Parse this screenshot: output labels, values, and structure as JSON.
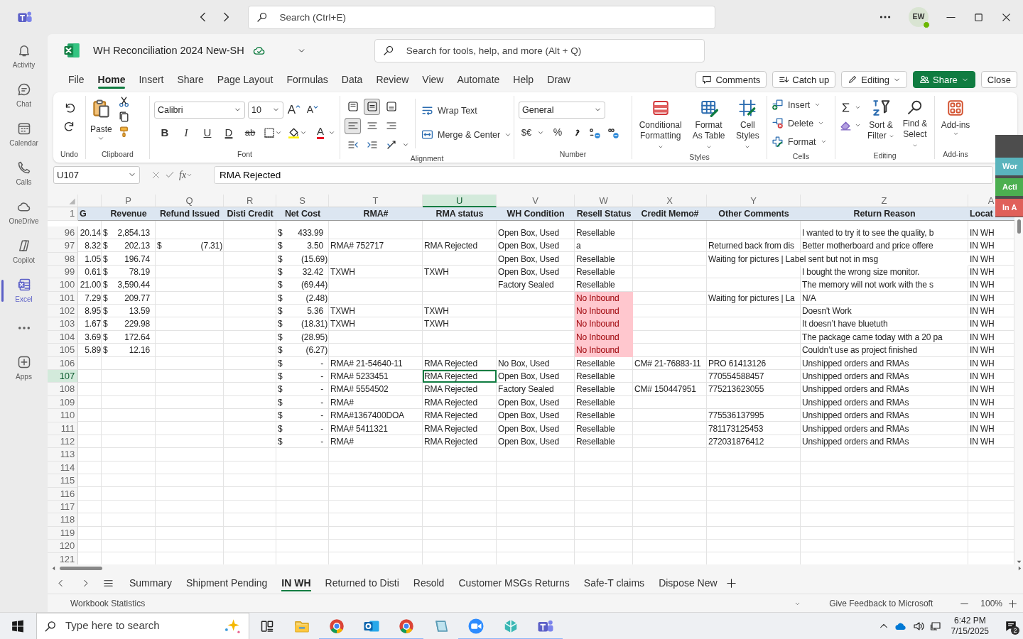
{
  "teams": {
    "search_placeholder": "Search (Ctrl+E)",
    "avatar": "EW"
  },
  "rail": [
    {
      "label": "Activity",
      "selected": false
    },
    {
      "label": "Chat",
      "selected": false
    },
    {
      "label": "Calendar",
      "selected": false
    },
    {
      "label": "Calls",
      "selected": false
    },
    {
      "label": "OneDrive",
      "selected": false
    },
    {
      "label": "Copilot",
      "selected": false
    },
    {
      "label": "Excel",
      "selected": true
    },
    {
      "label": "Apps",
      "selected": false
    }
  ],
  "workbook": {
    "title": "WH Reconciliation 2024 New-SH",
    "search_placeholder": "Search for tools, help, and more (Alt + Q)"
  },
  "menu_tabs": [
    {
      "label": "File",
      "selected": false
    },
    {
      "label": "Home",
      "selected": true
    },
    {
      "label": "Insert",
      "selected": false
    },
    {
      "label": "Share",
      "selected": false
    },
    {
      "label": "Page Layout",
      "selected": false
    },
    {
      "label": "Formulas",
      "selected": false
    },
    {
      "label": "Data",
      "selected": false
    },
    {
      "label": "Review",
      "selected": false
    },
    {
      "label": "View",
      "selected": false
    },
    {
      "label": "Automate",
      "selected": false
    },
    {
      "label": "Help",
      "selected": false
    },
    {
      "label": "Draw",
      "selected": false
    }
  ],
  "actions": [
    "Comments",
    "Catch up",
    "Editing",
    "Share",
    "Close"
  ],
  "ribbon": {
    "groups": [
      "Undo",
      "Clipboard",
      "Font",
      "Alignment",
      "Number",
      "Styles",
      "Cells",
      "Editing",
      "Add-ins"
    ],
    "paste": "Paste",
    "font_name": "Calibri",
    "font_size": "10",
    "font_buttons": [
      {
        "label": "A",
        "kind": "grow"
      },
      {
        "label": "A",
        "kind": "shrink"
      },
      {
        "label": "B",
        "kind": "bold"
      },
      {
        "label": "I",
        "kind": "italic"
      },
      {
        "label": "U",
        "kind": "underline"
      },
      {
        "label": "D",
        "kind": "double-underline"
      },
      {
        "label": "ab",
        "kind": "strikethrough"
      },
      {
        "label": "A",
        "kind": "font-color"
      }
    ],
    "align_buttons": [
      {
        "selected": false
      },
      {
        "selected": true
      },
      {
        "selected": false
      },
      {
        "selected": true
      },
      {
        "selected": false
      },
      {
        "selected": false
      }
    ],
    "wrap_text": "Wrap Text",
    "merge": "Merge & Center",
    "number_format": "General",
    "number_buttons": [
      "$€",
      "%"
    ],
    "styles": [
      "Conditional Formatting",
      "Format As Table",
      "Cell Styles"
    ],
    "cells": [
      "Insert",
      "Delete",
      "Format"
    ],
    "editing": [
      "Sort & Filter",
      "Find & Select"
    ],
    "addins": "Add-ins"
  },
  "formula_bar": {
    "name_box": "U107",
    "function": "fx",
    "value": "RMA Rejected"
  },
  "grid": {
    "columns": [
      {
        "selected": false
      },
      {
        "letter": "P",
        "selected": false
      },
      {
        "letter": "Q",
        "selected": false
      },
      {
        "letter": "R",
        "selected": false
      },
      {
        "letter": "S",
        "selected": false
      },
      {
        "letter": "T",
        "selected": false
      },
      {
        "letter": "U",
        "selected": true
      },
      {
        "letter": "V",
        "selected": false
      },
      {
        "letter": "W",
        "selected": false
      },
      {
        "letter": "X",
        "selected": false
      },
      {
        "letter": "Y",
        "selected": false
      },
      {
        "letter": "Z",
        "selected": false
      },
      {
        "letter": "A",
        "selected": false
      }
    ],
    "header_row": {
      "number": "1",
      "cells": [
        "G",
        "Revenue",
        "Refund Issued",
        "Disti Credit",
        "Net Cost",
        "RMA#",
        "RMA status",
        "WH Condition",
        "Resell Status",
        "Credit Memo#",
        "Other Comments",
        "Return Reason",
        "Locat"
      ]
    },
    "rows": [
      {
        "number": "96",
        "selected": false,
        "cells": [
          {
            "value": "20.14"
          },
          {
            "currency": "$",
            "amount": "2,854.13"
          },
          null,
          null,
          {
            "currency": "$",
            "amount": "433.99"
          },
          null,
          null,
          "Open Box, Used",
          "Resellable",
          null,
          null,
          "I wanted to try it to see the quality, b",
          "IN WH"
        ]
      },
      {
        "number": "97",
        "selected": false,
        "cells": [
          {
            "value": "8.32"
          },
          {
            "currency": "$",
            "amount": "202.13"
          },
          {
            "currency": "$",
            "amount": "(7.31)"
          },
          null,
          {
            "currency": "$",
            "amount": "3.50"
          },
          "RMA# 752717",
          "RMA Rejected",
          "Open Box, Used",
          "a",
          null,
          "Returned back from dis",
          "Better motherboard and price offere",
          "IN WH"
        ]
      },
      {
        "number": "98",
        "selected": false,
        "cells": [
          {
            "value": "1.05"
          },
          {
            "currency": "$",
            "amount": "196.74"
          },
          null,
          null,
          {
            "currency": "$",
            "amount": "(15.69)"
          },
          null,
          null,
          "Open Box, Used",
          "Resellable",
          null,
          "Waiting for pictures | Label sent but not in msg",
          null,
          "IN WH"
        ]
      },
      {
        "number": "99",
        "selected": false,
        "cells": [
          {
            "value": "0.61"
          },
          {
            "currency": "$",
            "amount": "78.19"
          },
          null,
          null,
          {
            "currency": "$",
            "amount": "32.42"
          },
          "TXWH",
          "TXWH",
          "Open Box, Used",
          "Resellable",
          null,
          null,
          "I bought the wrong size monitor.",
          "IN WH"
        ]
      },
      {
        "number": "100",
        "selected": false,
        "cells": [
          {
            "value": "21.00"
          },
          {
            "currency": "$",
            "amount": "3,590.44"
          },
          null,
          null,
          {
            "currency": "$",
            "amount": "(69.44)"
          },
          null,
          null,
          "Factory Sealed",
          "Resellable",
          null,
          null,
          "The memory will not work with the s",
          "IN WH"
        ]
      },
      {
        "number": "101",
        "selected": false,
        "cells": [
          {
            "value": "7.29"
          },
          {
            "currency": "$",
            "amount": "209.77"
          },
          null,
          null,
          {
            "currency": "$",
            "amount": "(2.48)"
          },
          null,
          null,
          null,
          {
            "text": "No Inbound",
            "alert": true
          },
          null,
          "Waiting for pictures | La",
          "N/A",
          "IN WH"
        ]
      },
      {
        "number": "102",
        "selected": false,
        "cells": [
          {
            "value": "8.95"
          },
          {
            "currency": "$",
            "amount": "13.59"
          },
          null,
          null,
          {
            "currency": "$",
            "amount": "5.36"
          },
          "TXWH",
          "TXWH",
          null,
          {
            "text": "No Inbound",
            "alert": true
          },
          null,
          null,
          "Doesn't Work",
          "IN WH"
        ]
      },
      {
        "number": "103",
        "selected": false,
        "cells": [
          {
            "value": "1.67"
          },
          {
            "currency": "$",
            "amount": "229.98"
          },
          null,
          null,
          {
            "currency": "$",
            "amount": "(18.31)"
          },
          "TXWH",
          "TXWH",
          null,
          {
            "text": "No Inbound",
            "alert": true
          },
          null,
          null,
          "It doesn’t have bluetuth",
          "IN WH"
        ]
      },
      {
        "number": "104",
        "selected": false,
        "cells": [
          {
            "value": "3.69"
          },
          {
            "currency": "$",
            "amount": "172.64"
          },
          null,
          null,
          {
            "currency": "$",
            "amount": "(28.95)"
          },
          null,
          null,
          null,
          {
            "text": "No Inbound",
            "alert": true
          },
          null,
          null,
          "The package came today with a 20 pa",
          "IN WH"
        ]
      },
      {
        "number": "105",
        "selected": false,
        "cells": [
          {
            "value": "5.89"
          },
          {
            "currency": "$",
            "amount": "12.16"
          },
          null,
          null,
          {
            "currency": "$",
            "amount": "(6.27)"
          },
          null,
          null,
          null,
          {
            "text": "No Inbound",
            "alert": true
          },
          null,
          null,
          "Couldn’t use as project finished",
          "IN WH"
        ]
      },
      {
        "number": "106",
        "selected": false,
        "cells": [
          null,
          null,
          null,
          null,
          {
            "currency": "$",
            "amount": "-"
          },
          "RMA# 21-54640-11",
          "RMA Rejected",
          "No Box, Used",
          "Resellable",
          "CM# 21-76883-11",
          "PRO 61413126",
          "Unshipped orders and RMAs",
          "IN WH"
        ]
      },
      {
        "number": "107",
        "selected": true,
        "cells": [
          null,
          null,
          null,
          null,
          {
            "currency": "$",
            "amount": "-"
          },
          "RMA# 5233451",
          "RMA Rejected",
          "Open Box, Used",
          "Resellable",
          null,
          "770554588457",
          "Unshipped orders and RMAs",
          "IN WH"
        ]
      },
      {
        "number": "108",
        "selected": false,
        "cells": [
          null,
          null,
          null,
          null,
          {
            "currency": "$",
            "amount": "-"
          },
          "RMA# 5554502",
          "RMA Rejected",
          "Factory Sealed",
          "Resellable",
          "CM# 150447951",
          "775213623055",
          "Unshipped orders and RMAs",
          "IN WH"
        ]
      },
      {
        "number": "109",
        "selected": false,
        "cells": [
          null,
          null,
          null,
          null,
          {
            "currency": "$",
            "amount": "-"
          },
          "RMA#",
          "RMA Rejected",
          "Open Box, Used",
          "Resellable",
          null,
          null,
          "Unshipped orders and RMAs",
          "IN WH"
        ]
      },
      {
        "number": "110",
        "selected": false,
        "cells": [
          null,
          null,
          null,
          null,
          {
            "currency": "$",
            "amount": "-"
          },
          "RMA#1367400DOA",
          "RMA Rejected",
          "Open Box, Used",
          "Resellable",
          null,
          "775536137995",
          "Unshipped orders and RMAs",
          "IN WH"
        ]
      },
      {
        "number": "111",
        "selected": false,
        "cells": [
          null,
          null,
          null,
          null,
          {
            "currency": "$",
            "amount": "-"
          },
          "RMA# 5411321",
          "RMA Rejected",
          "Open Box, Used",
          "Resellable",
          null,
          "781173125453",
          "Unshipped orders and RMAs",
          "IN WH"
        ]
      },
      {
        "number": "112",
        "selected": false,
        "cells": [
          null,
          null,
          null,
          null,
          {
            "currency": "$",
            "amount": "-"
          },
          "RMA#",
          "RMA Rejected",
          "Open Box, Used",
          "Resellable",
          null,
          "272031876412",
          "Unshipped orders and RMAs",
          "IN WH"
        ]
      },
      {
        "number": "113",
        "selected": false
      },
      {
        "number": "114",
        "selected": false
      },
      {
        "number": "115",
        "selected": false
      },
      {
        "number": "116",
        "selected": false
      },
      {
        "number": "117",
        "selected": false
      },
      {
        "number": "118",
        "selected": false
      },
      {
        "number": "119",
        "selected": false
      },
      {
        "number": "120",
        "selected": false
      },
      {
        "number": "121",
        "selected": false
      }
    ]
  },
  "side_panel": [
    {
      "label": "Wor",
      "color": "#5ab4bd"
    },
    {
      "label": "Acti",
      "color": "#4caf50"
    },
    {
      "label": "In A",
      "color": "#e0605a"
    }
  ],
  "sheet_tabs": [
    {
      "label": "Summary",
      "selected": false
    },
    {
      "label": "Shipment Pending",
      "selected": false
    },
    {
      "label": "IN WH",
      "selected": true
    },
    {
      "label": "Returned to Disti",
      "selected": false
    },
    {
      "label": "Resold",
      "selected": false
    },
    {
      "label": "Customer MSGs Returns",
      "selected": false
    },
    {
      "label": "Safe-T claims",
      "selected": false
    },
    {
      "label": "Dispose New",
      "selected": false
    }
  ],
  "status_bar": {
    "left": "Workbook Statistics",
    "feedback": "Give Feedback to Microsoft",
    "zoom": "100%"
  },
  "taskbar": {
    "search_placeholder": "Type here to search",
    "time": "6:42 PM",
    "date": "7/15/2025",
    "notifications": "2"
  }
}
